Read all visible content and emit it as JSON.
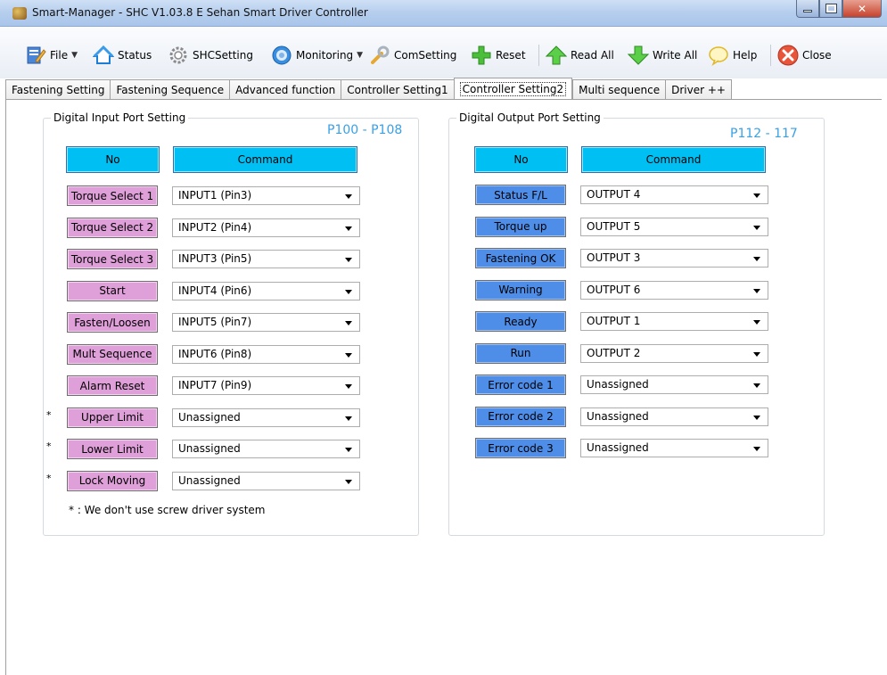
{
  "window": {
    "title": "Smart-Manager - SHC  V1.03.8 E  Sehan Smart Driver Controller"
  },
  "toolbar": {
    "file": "File",
    "status": "Status",
    "shcsetting": "SHCSetting",
    "monitoring": "Monitoring",
    "comsetting": "ComSetting",
    "reset": "Reset",
    "read_all": "Read All",
    "write_all": "Write All",
    "help": "Help",
    "close": "Close"
  },
  "tabs": [
    "Fastening Setting",
    "Fastening Sequence",
    "Advanced function",
    "Controller Setting1",
    "Controller Setting2",
    "Multi sequence",
    "Driver ++"
  ],
  "input_section": {
    "title": "Digital Input Port Setting",
    "range": "P100 - P108",
    "col_no": "No",
    "col_command": "Command",
    "rows": [
      {
        "name": "Torque Select 1",
        "value": "INPUT1 (Pin3)",
        "star": ""
      },
      {
        "name": "Torque Select 2",
        "value": "INPUT2 (Pin4)",
        "star": ""
      },
      {
        "name": "Torque Select 3",
        "value": "INPUT3 (Pin5)",
        "star": ""
      },
      {
        "name": "Start",
        "value": "INPUT4 (Pin6)",
        "star": ""
      },
      {
        "name": "Fasten/Loosen",
        "value": "INPUT5 (Pin7)",
        "star": ""
      },
      {
        "name": "Mult Sequence",
        "value": "INPUT6 (Pin8)",
        "star": ""
      },
      {
        "name": "Alarm Reset",
        "value": "INPUT7 (Pin9)",
        "star": ""
      },
      {
        "name": "Upper Limit",
        "value": "Unassigned",
        "star": "*"
      },
      {
        "name": "Lower Limit",
        "value": "Unassigned",
        "star": "*"
      },
      {
        "name": "Lock Moving",
        "value": "Unassigned",
        "star": "*"
      }
    ],
    "note": "* : We don't use screw driver system"
  },
  "output_section": {
    "title": "Digital Output Port Setting",
    "range": "P112 - 117",
    "col_no": "No",
    "col_command": "Command",
    "rows": [
      {
        "name": "Status F/L",
        "value": "OUTPUT 4"
      },
      {
        "name": "Torque up",
        "value": "OUTPUT 5"
      },
      {
        "name": "Fastening OK",
        "value": "OUTPUT 3"
      },
      {
        "name": "Warning",
        "value": "OUTPUT 6"
      },
      {
        "name": "Ready",
        "value": "OUTPUT 1"
      },
      {
        "name": "Run",
        "value": "OUTPUT 2"
      },
      {
        "name": "Error code 1",
        "value": "Unassigned"
      },
      {
        "name": "Error code 2",
        "value": "Unassigned"
      },
      {
        "name": "Error code 3",
        "value": "Unassigned"
      }
    ]
  },
  "colors": {
    "header": "#00bff3",
    "input_button": "#df9fd9",
    "output_button": "#4f8ee8",
    "range_text": "#3aa0e6"
  },
  "icons": [
    "app-icon",
    "file-icon",
    "home-icon",
    "gear-icon",
    "monitor-icon",
    "wrench-icon",
    "plus-icon",
    "read-arrow-icon",
    "write-arrow-icon",
    "help-bubble-icon",
    "close-icon"
  ]
}
